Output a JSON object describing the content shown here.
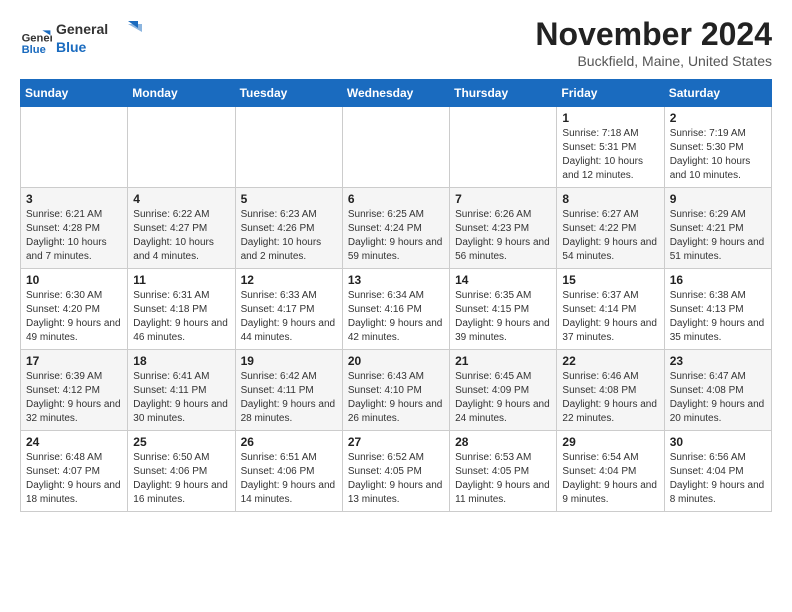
{
  "header": {
    "logo_general": "General",
    "logo_blue": "Blue",
    "month_year": "November 2024",
    "location": "Buckfield, Maine, United States"
  },
  "weekdays": [
    "Sunday",
    "Monday",
    "Tuesday",
    "Wednesday",
    "Thursday",
    "Friday",
    "Saturday"
  ],
  "weeks": [
    [
      {
        "day": "",
        "info": ""
      },
      {
        "day": "",
        "info": ""
      },
      {
        "day": "",
        "info": ""
      },
      {
        "day": "",
        "info": ""
      },
      {
        "day": "",
        "info": ""
      },
      {
        "day": "1",
        "info": "Sunrise: 7:18 AM\nSunset: 5:31 PM\nDaylight: 10 hours and 12 minutes."
      },
      {
        "day": "2",
        "info": "Sunrise: 7:19 AM\nSunset: 5:30 PM\nDaylight: 10 hours and 10 minutes."
      }
    ],
    [
      {
        "day": "3",
        "info": "Sunrise: 6:21 AM\nSunset: 4:28 PM\nDaylight: 10 hours and 7 minutes."
      },
      {
        "day": "4",
        "info": "Sunrise: 6:22 AM\nSunset: 4:27 PM\nDaylight: 10 hours and 4 minutes."
      },
      {
        "day": "5",
        "info": "Sunrise: 6:23 AM\nSunset: 4:26 PM\nDaylight: 10 hours and 2 minutes."
      },
      {
        "day": "6",
        "info": "Sunrise: 6:25 AM\nSunset: 4:24 PM\nDaylight: 9 hours and 59 minutes."
      },
      {
        "day": "7",
        "info": "Sunrise: 6:26 AM\nSunset: 4:23 PM\nDaylight: 9 hours and 56 minutes."
      },
      {
        "day": "8",
        "info": "Sunrise: 6:27 AM\nSunset: 4:22 PM\nDaylight: 9 hours and 54 minutes."
      },
      {
        "day": "9",
        "info": "Sunrise: 6:29 AM\nSunset: 4:21 PM\nDaylight: 9 hours and 51 minutes."
      }
    ],
    [
      {
        "day": "10",
        "info": "Sunrise: 6:30 AM\nSunset: 4:20 PM\nDaylight: 9 hours and 49 minutes."
      },
      {
        "day": "11",
        "info": "Sunrise: 6:31 AM\nSunset: 4:18 PM\nDaylight: 9 hours and 46 minutes."
      },
      {
        "day": "12",
        "info": "Sunrise: 6:33 AM\nSunset: 4:17 PM\nDaylight: 9 hours and 44 minutes."
      },
      {
        "day": "13",
        "info": "Sunrise: 6:34 AM\nSunset: 4:16 PM\nDaylight: 9 hours and 42 minutes."
      },
      {
        "day": "14",
        "info": "Sunrise: 6:35 AM\nSunset: 4:15 PM\nDaylight: 9 hours and 39 minutes."
      },
      {
        "day": "15",
        "info": "Sunrise: 6:37 AM\nSunset: 4:14 PM\nDaylight: 9 hours and 37 minutes."
      },
      {
        "day": "16",
        "info": "Sunrise: 6:38 AM\nSunset: 4:13 PM\nDaylight: 9 hours and 35 minutes."
      }
    ],
    [
      {
        "day": "17",
        "info": "Sunrise: 6:39 AM\nSunset: 4:12 PM\nDaylight: 9 hours and 32 minutes."
      },
      {
        "day": "18",
        "info": "Sunrise: 6:41 AM\nSunset: 4:11 PM\nDaylight: 9 hours and 30 minutes."
      },
      {
        "day": "19",
        "info": "Sunrise: 6:42 AM\nSunset: 4:11 PM\nDaylight: 9 hours and 28 minutes."
      },
      {
        "day": "20",
        "info": "Sunrise: 6:43 AM\nSunset: 4:10 PM\nDaylight: 9 hours and 26 minutes."
      },
      {
        "day": "21",
        "info": "Sunrise: 6:45 AM\nSunset: 4:09 PM\nDaylight: 9 hours and 24 minutes."
      },
      {
        "day": "22",
        "info": "Sunrise: 6:46 AM\nSunset: 4:08 PM\nDaylight: 9 hours and 22 minutes."
      },
      {
        "day": "23",
        "info": "Sunrise: 6:47 AM\nSunset: 4:08 PM\nDaylight: 9 hours and 20 minutes."
      }
    ],
    [
      {
        "day": "24",
        "info": "Sunrise: 6:48 AM\nSunset: 4:07 PM\nDaylight: 9 hours and 18 minutes."
      },
      {
        "day": "25",
        "info": "Sunrise: 6:50 AM\nSunset: 4:06 PM\nDaylight: 9 hours and 16 minutes."
      },
      {
        "day": "26",
        "info": "Sunrise: 6:51 AM\nSunset: 4:06 PM\nDaylight: 9 hours and 14 minutes."
      },
      {
        "day": "27",
        "info": "Sunrise: 6:52 AM\nSunset: 4:05 PM\nDaylight: 9 hours and 13 minutes."
      },
      {
        "day": "28",
        "info": "Sunrise: 6:53 AM\nSunset: 4:05 PM\nDaylight: 9 hours and 11 minutes."
      },
      {
        "day": "29",
        "info": "Sunrise: 6:54 AM\nSunset: 4:04 PM\nDaylight: 9 hours and 9 minutes."
      },
      {
        "day": "30",
        "info": "Sunrise: 6:56 AM\nSunset: 4:04 PM\nDaylight: 9 hours and 8 minutes."
      }
    ]
  ]
}
